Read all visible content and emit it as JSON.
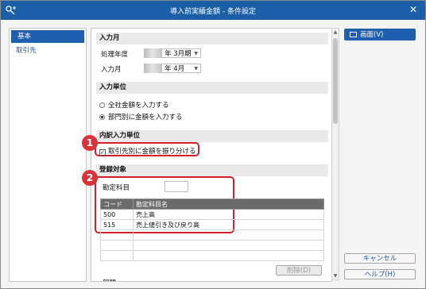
{
  "window": {
    "title": "導入前実績金額 - 条件設定",
    "close_symbol": "✕"
  },
  "sidebar": {
    "items": [
      {
        "label": "基本"
      },
      {
        "label": "取引先"
      }
    ]
  },
  "sections": {
    "input_month": {
      "title": "入力月",
      "fiscal_year_label": "処理年度",
      "fiscal_year_value": "年  3月期",
      "input_month_label": "入力月",
      "input_month_value": "年  4月"
    },
    "input_unit": {
      "title": "入力単位",
      "options": [
        {
          "label": "全社金額を入力する",
          "selected": false
        },
        {
          "label": "部門別に金額を入力する",
          "selected": true
        }
      ]
    },
    "breakdown_unit": {
      "title": "内訳入力単位",
      "checkbox_label": "取引先別に金額を振り分ける",
      "checked": true
    },
    "registration": {
      "title": "登録対象",
      "account_label": "勘定科目",
      "table": {
        "headers": [
          "コード",
          "勘定科目名"
        ],
        "rows": [
          [
            "500",
            "売上高"
          ],
          [
            "515",
            "売上値引き及び戻り高"
          ],
          [
            "",
            ""
          ],
          [
            "",
            ""
          ],
          [
            "",
            ""
          ]
        ]
      },
      "delete_button": "削除(D)",
      "next_label": "部門"
    }
  },
  "badges": [
    "1",
    "2"
  ],
  "right_panel": {
    "screen_button": "画面(V)",
    "cancel_button": "キャンセル",
    "help_button": "ヘルプ(H)"
  },
  "colors": {
    "titlebar": "#1a5fa8",
    "accent": "#1f5fb0",
    "highlight": "#d0202a"
  }
}
